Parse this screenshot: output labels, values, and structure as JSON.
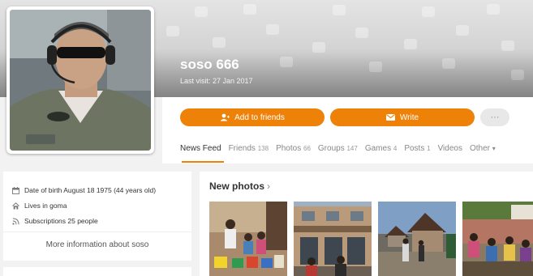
{
  "profile": {
    "name": "soso 666",
    "last_visit": "Last visit: 27 Jan 2017"
  },
  "actions": {
    "add_friends": "Add to friends",
    "write": "Write",
    "more": "···"
  },
  "tabs": [
    {
      "label": "News Feed",
      "count": ""
    },
    {
      "label": "Friends",
      "count": "138"
    },
    {
      "label": "Photos",
      "count": "66"
    },
    {
      "label": "Groups",
      "count": "147"
    },
    {
      "label": "Games",
      "count": "4"
    },
    {
      "label": "Posts",
      "count": "1"
    },
    {
      "label": "Videos",
      "count": ""
    },
    {
      "label": "Other",
      "count": ""
    }
  ],
  "other_chevron": "▾",
  "info": {
    "birth": "Date of birth August 18 1975 (44 years old)",
    "lives": "Lives in goma",
    "subscriptions": "Subscriptions 25 people",
    "more_link": "More information about soso"
  },
  "photos": {
    "title": "New photos",
    "chevron": "›"
  },
  "colors": {
    "accent": "#ee8208",
    "page_bg": "#f2f2f2"
  }
}
